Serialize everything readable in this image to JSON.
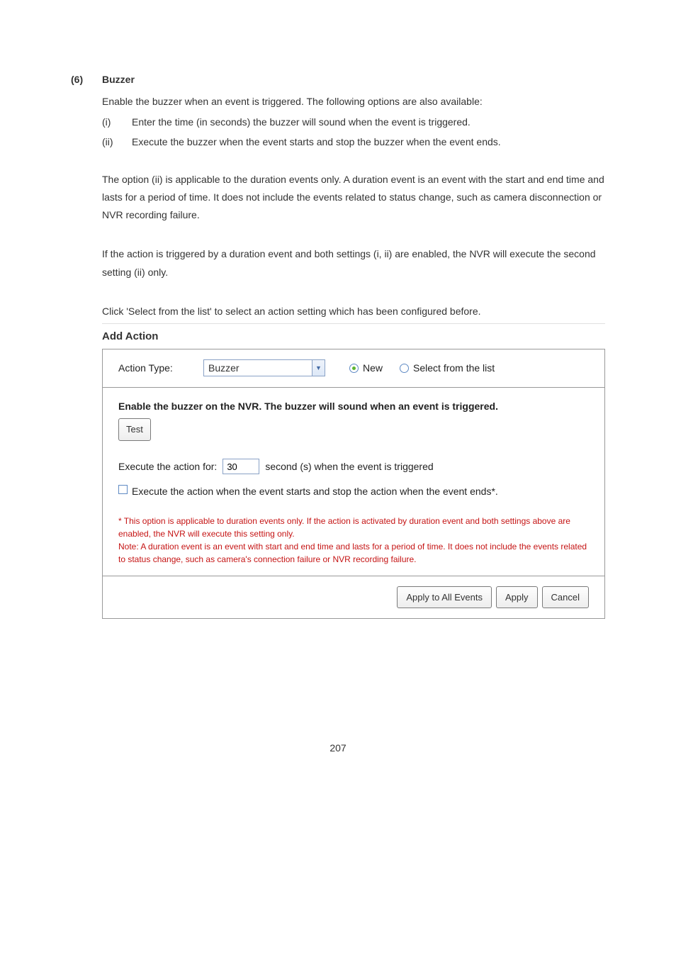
{
  "section": {
    "number": "(6)",
    "title": "Buzzer"
  },
  "intro": "Enable the buzzer when an event is triggered.   The following options are also available:",
  "list": [
    {
      "marker": "(i)",
      "text": "Enter the time (in seconds) the buzzer will sound when the event is triggered."
    },
    {
      "marker": "(ii)",
      "text": "Execute the buzzer when the event starts and stop the buzzer when the event ends."
    }
  ],
  "para1": "The option (ii) is applicable to the duration events only.   A duration event is an event with the start and end time and lasts for a period of time.   It does not include the events related to status change, such as camera disconnection or NVR recording failure.",
  "para2": "If the action is triggered by a duration event and both settings (i, ii) are enabled, the NVR will execute the second setting (ii) only.",
  "para3": "Click 'Select from the list' to select an action setting which has been configured before.",
  "screenshot": {
    "title": "Add Action",
    "actionTypeLabel": "Action Type:",
    "actionTypeValue": "Buzzer",
    "radioNew": "New",
    "radioSelect": "Select from the list",
    "enableLine": "Enable the buzzer on the NVR. The buzzer will sound when an event is triggered.",
    "testBtn": "Test",
    "executePrefix": "Execute the action for:",
    "executeValue": "30",
    "executeSuffix": "second (s) when the event is triggered",
    "checkbox": "Execute the action when the event starts and stop the action when the event ends*.",
    "note1": "* This option is applicable to duration events only. If the action is activated by duration event and both settings above are enabled, the NVR will execute this setting only.",
    "note2": "Note: A duration event is an event with start and end time and lasts for a period of time. It does not include the events related to status change, such as camera's connection failure or NVR recording failure.",
    "applyAll": "Apply to All Events",
    "apply": "Apply",
    "cancel": "Cancel"
  },
  "pageNumber": "207"
}
